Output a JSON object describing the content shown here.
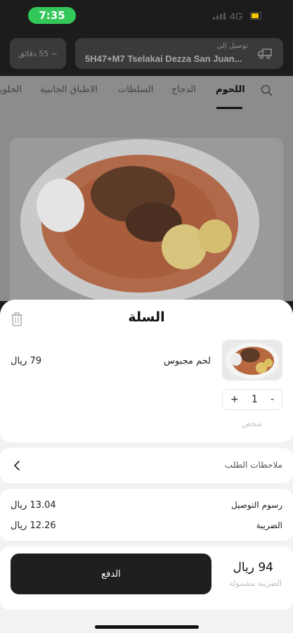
{
  "status_bar": {
    "time": "7:35",
    "network": "4G",
    "colors": {
      "time_pill": "#34c759",
      "battery": "#f7c600"
    }
  },
  "header": {
    "delivery_time": "~ 55 دقائق",
    "delivery_caption": "توصيل إلى",
    "address": "5H47+M7 Tselakai Dezza San Juan...",
    "icons": {
      "truck": "delivery-truck-icon"
    }
  },
  "menu": {
    "tabs": [
      {
        "label": "اللحوم",
        "active": true
      },
      {
        "label": "الدجاج",
        "active": false
      },
      {
        "label": "السلطات",
        "active": false
      },
      {
        "label": "الاطباق الجانبية",
        "active": false
      },
      {
        "label": "الحلويات",
        "active": false
      }
    ],
    "icons": {
      "search": "search-icon"
    }
  },
  "cart": {
    "title": "السلة",
    "icons": {
      "trash": "trash-icon",
      "collapse": "chevron-down-icon"
    },
    "item": {
      "name": "لحم مجبوس",
      "price": "79 ريال",
      "quantity": "1",
      "increment": "+",
      "decrement": "-",
      "note": "شخص"
    },
    "notes_label": "ملاحظات الطلب",
    "fees": [
      {
        "label": "رسوم التوصيل",
        "value": "13.04 ريال"
      },
      {
        "label": "الضريبة",
        "value": "12.26 ريال"
      }
    ],
    "total": "94 ريال",
    "tax_note": "الضريبة مشمولة",
    "pay_label": "الدفع"
  },
  "theme": {
    "dark": "#1c1c1c",
    "button": "#1f1f1f",
    "sheet_bg": "#f2f2f2"
  }
}
